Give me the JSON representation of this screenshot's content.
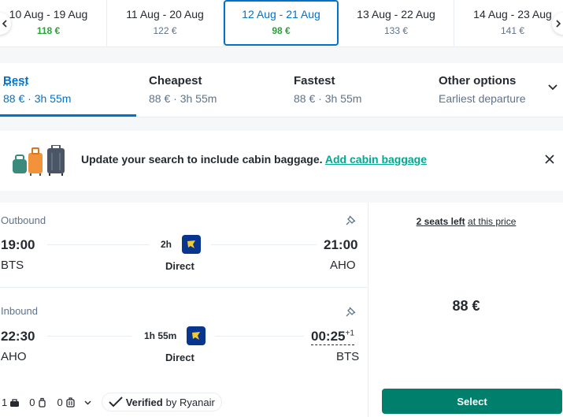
{
  "date_strip": {
    "dates": [
      {
        "label": "10 Aug - 19 Aug",
        "price": "118 €"
      },
      {
        "label": "11 Aug - 20 Aug",
        "price": "122 €"
      },
      {
        "label": "12 Aug - 21 Aug",
        "price": "98 €"
      },
      {
        "label": "13 Aug - 22 Aug",
        "price": "133 €"
      },
      {
        "label": "14 Aug - 23 Aug",
        "price": "141 €"
      }
    ],
    "selected_index": 2,
    "cheapest_color": "#28a138",
    "selected_color": "#0172cb",
    "prev_icon": "chevron-left-icon",
    "next_icon": "chevron-right-icon"
  },
  "sort_tabs": [
    {
      "title": "Best",
      "subtitle": "88 € · 3h 55m"
    },
    {
      "title": "Cheapest",
      "subtitle": "88 € · 3h 55m"
    },
    {
      "title": "Fastest",
      "subtitle": "88 € · 3h 55m"
    },
    {
      "title": "Other options",
      "subtitle": "Earliest departure"
    }
  ],
  "banner": {
    "text": "Update your search to include cabin baggage.",
    "link": "Add cabin baggage",
    "icon": "luggage-icon",
    "close_icon": "close-icon"
  },
  "result": {
    "outbound": {
      "label": "Outbound",
      "depart_time": "19:00",
      "depart_code": "BTS",
      "duration": "2h",
      "stops": "Direct",
      "arrive_time": "21:00",
      "arrive_code": "AHO"
    },
    "inbound": {
      "label": "Inbound",
      "depart_time": "22:30",
      "depart_code": "AHO",
      "duration": "1h 55m",
      "stops": "Direct",
      "arrive_time": "00:25",
      "arrive_day_offset": "+1",
      "arrive_code": "BTS"
    },
    "bags": {
      "personal": "1",
      "cabin": "0",
      "checked": "0"
    },
    "verified_label": "Verified",
    "verified_by": "by Ryanair",
    "seats_count": "2 seats left",
    "seats_rest": "at this price",
    "price": "88 €",
    "select_label": "Select",
    "accent": "#00806c"
  }
}
